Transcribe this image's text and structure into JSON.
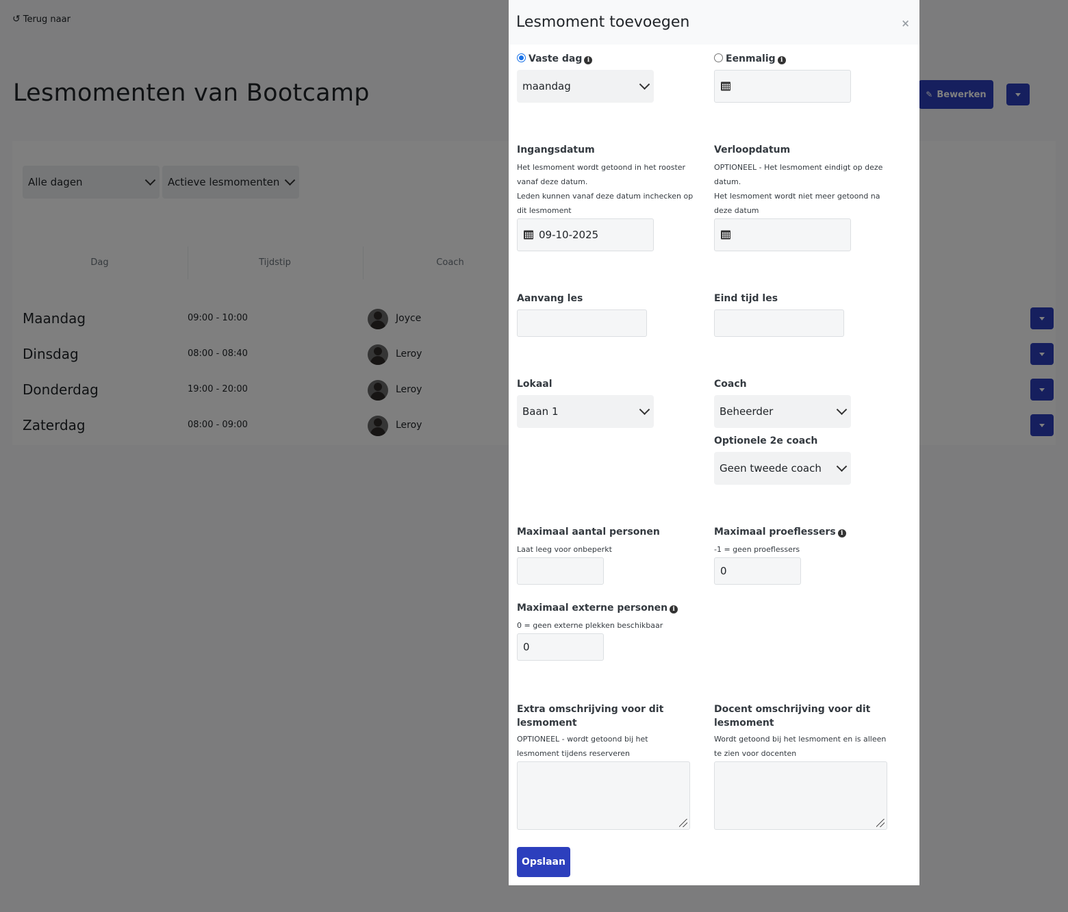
{
  "page": {
    "back_link": "Terug naar",
    "title": "Lesmomenten van Bootcamp",
    "edit_button": "Bewerken",
    "filters": {
      "day": "Alle dagen",
      "status": "Actieve lesmomenten"
    },
    "table": {
      "headers": [
        "Dag",
        "Tijdstip",
        "Coach"
      ],
      "rows": [
        {
          "day": "Maandag",
          "time": "09:00 - 10:00",
          "coach": "Joyce"
        },
        {
          "day": "Dinsdag",
          "time": "08:00 - 08:40",
          "coach": "Leroy"
        },
        {
          "day": "Donderdag",
          "time": "19:00 - 20:00",
          "coach": "Leroy"
        },
        {
          "day": "Zaterdag",
          "time": "08:00 - 09:00",
          "coach": "Leroy"
        }
      ]
    }
  },
  "modal": {
    "title": "Lesmoment toevoegen",
    "close": "×",
    "fixed_day": {
      "label": "Vaste dag",
      "checked": true,
      "value": "maandag"
    },
    "once": {
      "label": "Eenmalig",
      "checked": false,
      "value": ""
    },
    "start_date": {
      "label": "Ingangsdatum",
      "help1": "Het lesmoment wordt getoond in het rooster vanaf deze datum.",
      "help2": "Leden kunnen vanaf deze datum inchecken op dit lesmoment",
      "value": "09-10-2025"
    },
    "end_date": {
      "label": "Verloopdatum",
      "help1": "OPTIONEEL - Het lesmoment eindigt op deze datum.",
      "help2": "Het lesmoment wordt niet meer getoond na deze datum",
      "value": ""
    },
    "start_time": {
      "label": "Aanvang les",
      "value": ""
    },
    "end_time": {
      "label": "Eind tijd les",
      "value": ""
    },
    "room": {
      "label": "Lokaal",
      "value": "Baan 1"
    },
    "coach": {
      "label": "Coach",
      "value": "Beheerder"
    },
    "second_coach": {
      "label": "Optionele 2e coach",
      "value": "Geen tweede coach"
    },
    "max_persons": {
      "label": "Maximaal aantal personen",
      "help": "Laat leeg voor onbeperkt",
      "value": ""
    },
    "max_trial": {
      "label": "Maximaal proeflessers",
      "help": "-1 = geen proeflessers",
      "value": "0"
    },
    "max_external": {
      "label": "Maximaal externe personen",
      "help": "0 = geen externe plekken beschikbaar",
      "value": "0"
    },
    "extra_desc": {
      "label": "Extra omschrijving voor dit lesmoment",
      "help": "OPTIONEEL - wordt getoond bij het lesmoment tijdens reserveren"
    },
    "teacher_desc": {
      "label": "Docent omschrijving voor dit lesmoment",
      "help": "Wordt getoond bij het lesmoment en is alleen te zien voor docenten"
    },
    "save": "Opslaan"
  },
  "colors": {
    "primary": "#2c3fbd",
    "overlay": "rgba(0,0,0,0.5)"
  }
}
